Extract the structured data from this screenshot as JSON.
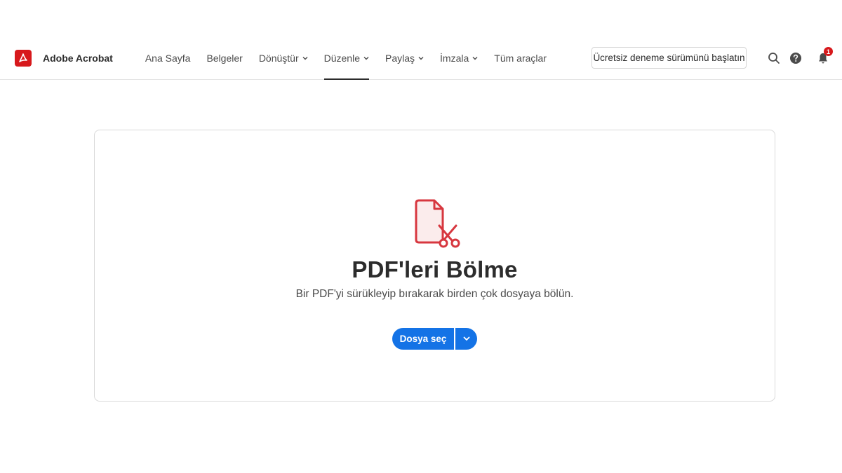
{
  "app": {
    "name": "Adobe Acrobat",
    "logo": "acrobat-logo-icon",
    "brand_color": "#d7191c"
  },
  "nav": {
    "items": [
      {
        "label": "Ana Sayfa",
        "dropdown": false
      },
      {
        "label": "Belgeler",
        "dropdown": false
      },
      {
        "label": "Dönüştür",
        "dropdown": true
      },
      {
        "label": "Düzenle",
        "dropdown": true,
        "active": true
      },
      {
        "label": "Paylaş",
        "dropdown": true
      },
      {
        "label": "İmzala",
        "dropdown": true
      },
      {
        "label": "Tüm araçlar",
        "dropdown": false
      }
    ]
  },
  "header": {
    "trial_button": "Ücretsiz deneme sürümünü başlatın",
    "icons": [
      "search-icon",
      "help-icon",
      "bell-icon"
    ],
    "notification_count": "1"
  },
  "main": {
    "tool_icon": "split-pdf-icon",
    "title": "PDF'leri Bölme",
    "subtitle": "Bir PDF'yi sürükleyip bırakarak birden çok dosyaya bölün.",
    "primary_button": "Dosya seç",
    "accent_color": "#1473e6"
  }
}
